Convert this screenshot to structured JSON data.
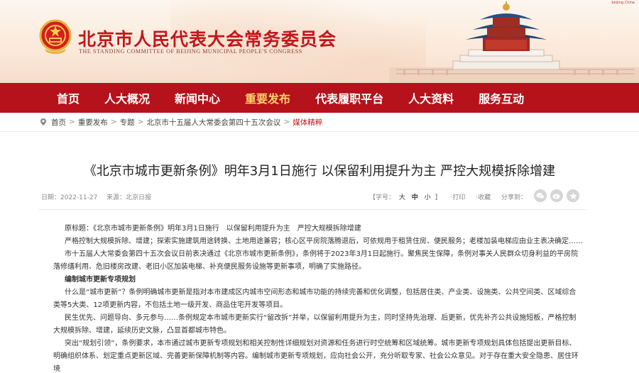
{
  "header": {
    "title": "北京市人民代表大会常务委员会",
    "subtitle": "THE STANDING COMMITTEE OF BEIJING MUNICIPAL PEOPLE'S CONGRESS",
    "corner_tag": "beijing.China",
    "brand_color": "#c4161c"
  },
  "nav": {
    "items": [
      {
        "label": "首页"
      },
      {
        "label": "人大概况"
      },
      {
        "label": "新闻中心"
      },
      {
        "label": "重要发布"
      },
      {
        "label": "代表履职平台"
      },
      {
        "label": "人大资料"
      },
      {
        "label": "服务互动"
      }
    ],
    "active": "重要发布",
    "bg_color": "#b5121b",
    "active_color": "#ffd16a"
  },
  "breadcrumb": {
    "home": "首页",
    "items": [
      "重要发布",
      "专题",
      "北京市十五届人大常委会第四十五次会议"
    ],
    "current": "媒体精粹",
    "separator": ">"
  },
  "article": {
    "title": "《北京市城市更新条例》明年3月1日施行 以保留利用提升为主 严控大规模拆除增建",
    "date": "日期：2022-11-27",
    "source": "来源：北京日报",
    "font_label": "【字号：",
    "font_sizes": [
      "大",
      "中",
      "小"
    ],
    "font_close": "】",
    "print": "·打印",
    "favorite": "·收藏",
    "share_label": "分享到：",
    "share_icons": [
      "wechat-icon",
      "weibo-icon",
      "favorite-star-icon"
    ],
    "paragraphs": [
      {
        "type": "normal",
        "text": "原标题：《北京市城市更新条例》明年3月1日施行　以保留利用提升为主　严控大规模拆除增建"
      },
      {
        "type": "normal",
        "text": "严格控制大规模拆除、增建；探索实施建筑用途转换、土地用途兼容；核心区平房院落腾退后，可依规用于租赁住房、便民服务；老楼加装电梯应由业主表决确定……"
      },
      {
        "type": "normal",
        "text": "市十五届人大常委会第四十五次会议日前表决通过《北京市城市更新条例》，条例将于2023年3月1日起施行。聚焦民生保障，条例对事关人民群众切身利益的平房院落修缮利用、危旧楼房改建、老旧小区加装电梯、补充便民服务设施等更新事项，明确了实施路径。"
      },
      {
        "type": "sub",
        "text": "编制城市更新专项规划"
      },
      {
        "type": "normal",
        "text": "什么是“城市更新”？条例明确城市更新是指对本市建成区内城市空间形态和城市功能的持续完善和优化调整，包括居住类、产业类、设施类、公共空间类、区域综合类等5大类、12项更新内容，不包括土地一级开发、商品住宅开发等项目。"
      },
      {
        "type": "normal",
        "text": "民生优先、问题导向、多元参与……条例规定本市城市更新实行“留改拆”并举，以保留利用提升为主，同时坚持先治理、后更新，优先补齐公共设施短板，严格控制大规模拆除、增建，延续历史文脉，凸显首都城市特色。"
      },
      {
        "type": "normal",
        "text": "突出“规划引领”，条例要求，本市通过城市更新专项规划和相关控制性详细规划对资源和任务进行时空统筹和区域统筹。城市更新专项规划具体包括提出更新目标、明确组织体系、划定重点更新区域、完善更新保障机制等内容。编制城市更新专项规划，应向社会公开，充分听取专家、社会公众意见。对于存在重大安全隐患、居住环境"
      }
    ]
  }
}
